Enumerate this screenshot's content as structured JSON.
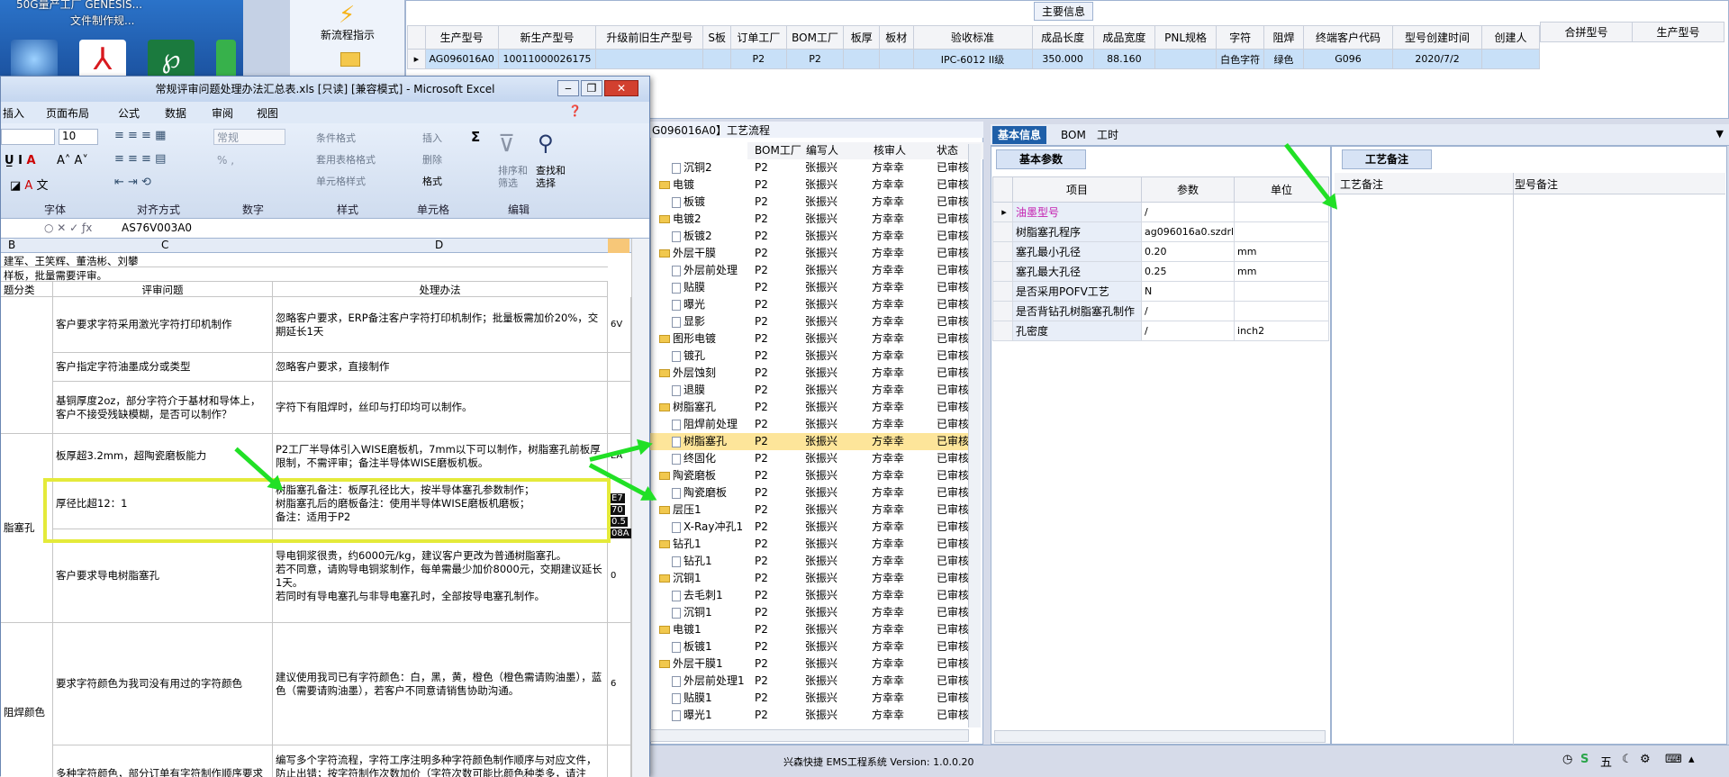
{
  "desktop": {
    "text_line1": "50G量产工厂 GENESIS...",
    "text_line2": "文件制作规..."
  },
  "launcher": {
    "label": "新流程指示"
  },
  "main_info": {
    "title": "主要信息",
    "columns": [
      "生产型号",
      "新生产型号",
      "升级前旧生产型号",
      "S板",
      "订单工厂",
      "BOM工厂",
      "板厚",
      "板材",
      "验收标准",
      "成品长度",
      "成品宽度",
      "PNL规格",
      "字符",
      "阻焊",
      "终端客户代码",
      "型号创建时间",
      "创建人"
    ],
    "row": [
      "AG096016A0",
      "10011000026175",
      "",
      "",
      "P2",
      "P2",
      "",
      "",
      "IPC-6012 II级",
      "350.000",
      "88.160",
      "",
      "白色字符",
      "绿色",
      "G096",
      "2020/7/2",
      ""
    ],
    "merge_columns": [
      "合拼型号",
      "生产型号"
    ]
  },
  "excel": {
    "title": "常规评审问题处理办法汇总表.xls [只读] [兼容模式] - Microsoft Excel",
    "menu": [
      "插入",
      "页面布局",
      "公式",
      "数据",
      "审阅",
      "视图"
    ],
    "font_size": "10",
    "format_box": "常规",
    "groups": [
      "字体",
      "对齐方式",
      "数字",
      "样式",
      "单元格",
      "编辑"
    ],
    "style_items": [
      "条件格式",
      "套用表格格式",
      "单元格样式"
    ],
    "cell_items": [
      "插入",
      "删除",
      "格式"
    ],
    "edit_items": [
      "排序和筛选",
      "查找和选择"
    ],
    "formula": "AS76V003A0",
    "col_headers": [
      "B",
      "C",
      "D"
    ],
    "top_line1": "建军、王笑辉、董浩彬、刘攀",
    "top_line2": "样板，批量需要评审。",
    "header_row": {
      "b": "题分类",
      "c": "评审问题",
      "d": "处理办法"
    },
    "rows": [
      {
        "c": "客户要求字符采用激光字符打印机制作",
        "d": "忽略客户要求，ERP备注客户字符打印机制作；批量板需加价20%，交期延长1天",
        "e": "6V"
      },
      {
        "c": "客户指定字符油墨成分或类型",
        "d": "忽略客户要求，直接制作"
      },
      {
        "c": "基铜厚度2oz，部分字符介于基材和导体上，客户不接受残缺模糊，是否可以制作？",
        "d": "字符下有阻焊时，丝印与打印均可以制作。"
      },
      {
        "c": "板厚超3.2mm，超陶瓷磨板能力",
        "d": "P2工厂半导体引入WISE磨板机，7mm以下可以制作，树脂塞孔前板厚限制，不需评审；备注半导体WISE磨板机板。",
        "e": "EA"
      },
      {
        "c": "厚径比超12：1",
        "d": "树脂塞孔备注：板厚孔径比大，按半导体塞孔参数制作；\n树脂塞孔后的磨板备注：使用半导体WISE磨板机磨板；\n备注：适用于P2"
      },
      {
        "c": "客户要求导电树脂塞孔",
        "d": "导电铜浆很贵，约6000元/kg，建议客户更改为普通树脂塞孔。\n若不同意，请购导电铜浆制作，每单需最少加价8000元，交期建议延长1天。\n若同时有导电塞孔与非导电塞孔时，全部按导电塞孔制作。",
        "e": "0"
      },
      {
        "c": "要求字符颜色为我司没有用过的字符颜色",
        "d": "建议使用我司已有字符颜色：白，黑，黄，橙色（橙色需请购油墨），蓝色（需要请购油墨），若客户不同意请销售协助沟通。",
        "e": "6"
      },
      {
        "c": "多种字符颜色，部分订单有字符制作顺序要求",
        "d": "编写多个字符流程，字符工序注明多种字符颜色制作顺序与对应文件，防止出错；按字符制作次数加价（字符次数可能比颜色种类多，请注意），交期延长1天，交期冲孔2次，注意加费用。例"
      }
    ],
    "category_1": "脂塞孔",
    "category_2": "阻焊颜色",
    "row_side_marks": [
      "E7",
      "70",
      "0.5",
      "08A"
    ]
  },
  "process": {
    "header": "G096016A0】工艺流程",
    "columns": [
      "BOM工厂",
      "编写人",
      "核审人",
      "状态"
    ],
    "rows": [
      {
        "name": "沉铜2",
        "kind": "doc",
        "indent": 1,
        "f": "P2",
        "w": "张振兴",
        "c": "方幸幸",
        "s": "已审核"
      },
      {
        "name": "电镀",
        "kind": "folder",
        "indent": 0,
        "f": "P2",
        "w": "张振兴",
        "c": "方幸幸",
        "s": "已审核"
      },
      {
        "name": "板镀",
        "kind": "doc",
        "indent": 1,
        "f": "P2",
        "w": "张振兴",
        "c": "方幸幸",
        "s": "已审核"
      },
      {
        "name": "电镀2",
        "kind": "folder",
        "indent": 0,
        "f": "P2",
        "w": "张振兴",
        "c": "方幸幸",
        "s": "已审核"
      },
      {
        "name": "板镀2",
        "kind": "doc",
        "indent": 1,
        "f": "P2",
        "w": "张振兴",
        "c": "方幸幸",
        "s": "已审核"
      },
      {
        "name": "外层干膜",
        "kind": "folder",
        "indent": 0,
        "f": "P2",
        "w": "张振兴",
        "c": "方幸幸",
        "s": "已审核"
      },
      {
        "name": "外层前处理",
        "kind": "doc",
        "indent": 1,
        "f": "P2",
        "w": "张振兴",
        "c": "方幸幸",
        "s": "已审核"
      },
      {
        "name": "贴膜",
        "kind": "doc",
        "indent": 1,
        "f": "P2",
        "w": "张振兴",
        "c": "方幸幸",
        "s": "已审核"
      },
      {
        "name": "曝光",
        "kind": "doc",
        "indent": 1,
        "f": "P2",
        "w": "张振兴",
        "c": "方幸幸",
        "s": "已审核"
      },
      {
        "name": "显影",
        "kind": "doc",
        "indent": 1,
        "f": "P2",
        "w": "张振兴",
        "c": "方幸幸",
        "s": "已审核"
      },
      {
        "name": "图形电镀",
        "kind": "folder",
        "indent": 0,
        "f": "P2",
        "w": "张振兴",
        "c": "方幸幸",
        "s": "已审核"
      },
      {
        "name": "镀孔",
        "kind": "doc",
        "indent": 1,
        "f": "P2",
        "w": "张振兴",
        "c": "方幸幸",
        "s": "已审核"
      },
      {
        "name": "外层蚀刻",
        "kind": "folder",
        "indent": 0,
        "f": "P2",
        "w": "张振兴",
        "c": "方幸幸",
        "s": "已审核"
      },
      {
        "name": "退膜",
        "kind": "doc",
        "indent": 1,
        "f": "P2",
        "w": "张振兴",
        "c": "方幸幸",
        "s": "已审核"
      },
      {
        "name": "树脂塞孔",
        "kind": "folder",
        "indent": 0,
        "f": "P2",
        "w": "张振兴",
        "c": "方幸幸",
        "s": "已审核"
      },
      {
        "name": "阻焊前处理",
        "kind": "doc",
        "indent": 1,
        "f": "P2",
        "w": "张振兴",
        "c": "方幸幸",
        "s": "已审核"
      },
      {
        "name": "树脂塞孔",
        "kind": "doc",
        "indent": 1,
        "f": "P2",
        "w": "张振兴",
        "c": "方幸幸",
        "s": "已审核",
        "selected": true
      },
      {
        "name": "终固化",
        "kind": "doc",
        "indent": 1,
        "f": "P2",
        "w": "张振兴",
        "c": "方幸幸",
        "s": "已审核"
      },
      {
        "name": "陶瓷磨板",
        "kind": "folder",
        "indent": 0,
        "f": "P2",
        "w": "张振兴",
        "c": "方幸幸",
        "s": "已审核"
      },
      {
        "name": "陶瓷磨板",
        "kind": "doc",
        "indent": 1,
        "f": "P2",
        "w": "张振兴",
        "c": "方幸幸",
        "s": "已审核"
      },
      {
        "name": "层压1",
        "kind": "folder",
        "indent": 0,
        "f": "P2",
        "w": "张振兴",
        "c": "方幸幸",
        "s": "已审核"
      },
      {
        "name": "X-Ray冲孔1",
        "kind": "doc",
        "indent": 1,
        "f": "P2",
        "w": "张振兴",
        "c": "方幸幸",
        "s": "已审核"
      },
      {
        "name": "钻孔1",
        "kind": "folder",
        "indent": 0,
        "f": "P2",
        "w": "张振兴",
        "c": "方幸幸",
        "s": "已审核"
      },
      {
        "name": "钻孔1",
        "kind": "doc",
        "indent": 1,
        "f": "P2",
        "w": "张振兴",
        "c": "方幸幸",
        "s": "已审核"
      },
      {
        "name": "沉铜1",
        "kind": "folder",
        "indent": 0,
        "f": "P2",
        "w": "张振兴",
        "c": "方幸幸",
        "s": "已审核"
      },
      {
        "name": "去毛刺1",
        "kind": "doc",
        "indent": 1,
        "f": "P2",
        "w": "张振兴",
        "c": "方幸幸",
        "s": "已审核"
      },
      {
        "name": "沉铜1",
        "kind": "doc",
        "indent": 1,
        "f": "P2",
        "w": "张振兴",
        "c": "方幸幸",
        "s": "已审核"
      },
      {
        "name": "电镀1",
        "kind": "folder",
        "indent": 0,
        "f": "P2",
        "w": "张振兴",
        "c": "方幸幸",
        "s": "已审核"
      },
      {
        "name": "板镀1",
        "kind": "doc",
        "indent": 1,
        "f": "P2",
        "w": "张振兴",
        "c": "方幸幸",
        "s": "已审核"
      },
      {
        "name": "外层干膜1",
        "kind": "folder",
        "indent": 0,
        "f": "P2",
        "w": "张振兴",
        "c": "方幸幸",
        "s": "已审核"
      },
      {
        "name": "外层前处理1",
        "kind": "doc",
        "indent": 1,
        "f": "P2",
        "w": "张振兴",
        "c": "方幸幸",
        "s": "已审核"
      },
      {
        "name": "贴膜1",
        "kind": "doc",
        "indent": 1,
        "f": "P2",
        "w": "张振兴",
        "c": "方幸幸",
        "s": "已审核"
      },
      {
        "name": "曝光1",
        "kind": "doc",
        "indent": 1,
        "f": "P2",
        "w": "张振兴",
        "c": "方幸幸",
        "s": "已审核"
      }
    ]
  },
  "right": {
    "tabs": [
      "基本信息",
      "BOM",
      "工时"
    ],
    "basic_tab": "基本参数",
    "param_cols": [
      "项目",
      "参数",
      "单位"
    ],
    "params": [
      {
        "item": "油墨型号",
        "value": "/",
        "unit": ""
      },
      {
        "item": "树脂塞孔程序",
        "value": "ag096016a0.szdrl",
        "unit": ""
      },
      {
        "item": "塞孔最小孔径",
        "value": "0.20",
        "unit": "mm"
      },
      {
        "item": "塞孔最大孔径",
        "value": "0.25",
        "unit": "mm"
      },
      {
        "item": "是否采用POFV工艺",
        "value": "N",
        "unit": ""
      },
      {
        "item": "是否背钻孔树脂塞孔制作",
        "value": "/",
        "unit": ""
      },
      {
        "item": "孔密度",
        "value": "/",
        "unit": "inch2"
      }
    ],
    "craft_tab": "工艺备注",
    "craft_cols": [
      "工艺备注",
      "型号备注"
    ]
  },
  "status": {
    "text": "兴森快捷 EMS工程系统 Version: 1.0.0.20",
    "tray": "五"
  },
  "colors": {
    "accent": "#21e026",
    "highlight": "#e4ea3a",
    "selected_row": "#fde59a"
  }
}
